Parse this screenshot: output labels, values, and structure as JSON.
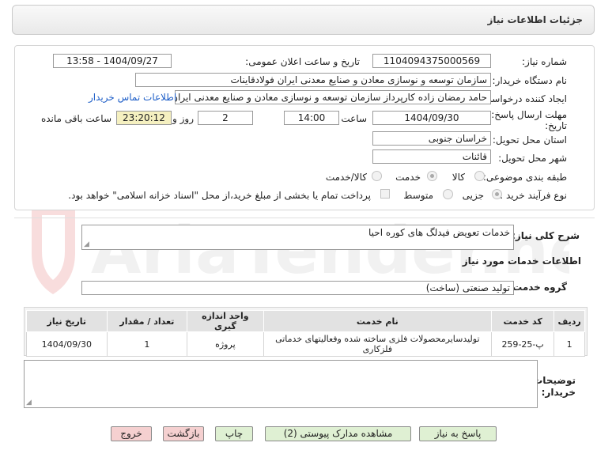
{
  "header": {
    "title": "جزئیات اطلاعات نیاز"
  },
  "form": {
    "need_number_label": "شماره نیاز:",
    "need_number": "1104094375000569",
    "announce_label": "تاریخ و ساعت اعلان عمومی:",
    "announce_value": "1404/09/27 - 13:58",
    "buyer_org_label": "نام دستگاه خریدار:",
    "buyer_org": "سازمان توسعه و نوسازی معادن و صنایع معدنی ایران فولادقاینات",
    "creator_label": "ایجاد کننده درخواست:",
    "creator": "حامد  رمضان زاده  کارپرداز  سازمان توسعه و نوسازی معادن و صنایع معدنی ایران",
    "contact_link": "اطلاعات تماس خریدار",
    "deadline_label_1": "مهلت ارسال پاسخ: تا",
    "deadline_label_2": "تاریخ:",
    "deadline_date": "1404/09/30",
    "time_label": "ساعت",
    "deadline_time": "14:00",
    "days_value": "2",
    "days_label": "روز و",
    "remaining_time": "23:20:12",
    "remaining_label": "ساعت باقی مانده",
    "province_label": "استان محل تحویل:",
    "province": "خراسان جنوبی",
    "city_label": "شهر محل تحویل:",
    "city": "قائنات",
    "category_label": "طبقه بندی موضوعی:",
    "category_options": [
      "کالا",
      "خدمت",
      "کالا/خدمت"
    ],
    "category_selected": "خدمت",
    "process_label": "نوع فرآیند خرید :",
    "process_options": [
      "جزیی",
      "متوسط"
    ],
    "process_selected": "جزیی",
    "payment_note": "پرداخت تمام یا بخشی از مبلغ خرید،از محل \"اسناد خزانه اسلامی\" خواهد بود."
  },
  "summary": {
    "label": "شرح کلی نیاز:",
    "value": "خدمات تعویض فیدلگ های کوره احیا"
  },
  "services": {
    "section_title": "اطلاعات خدمات مورد نیاز",
    "group_label": "گروه خدمت:",
    "group_value": "تولید صنعتی (ساخت)",
    "columns": [
      "ردیف",
      "کد خدمت",
      "نام خدمت",
      "واحد اندازه گیری",
      "تعداد / مقدار",
      "تاریخ نیاز"
    ],
    "rows": [
      {
        "index": "1",
        "code": "پ-25-259",
        "name": "تولیدسایرمحصولات فلزی ساخته شده وفعالیتهای خدماتی فلزکاری",
        "unit": "پروژه",
        "qty": "1",
        "date": "1404/09/30"
      }
    ]
  },
  "buyer_notes": {
    "label_1": "توضیحات",
    "label_2": "خریدار:",
    "value": ""
  },
  "buttons": {
    "reply": "پاسخ به نیاز",
    "attachments": "مشاهده مدارک پیوستی (2)",
    "print": "چاپ",
    "back": "بازگشت",
    "exit": "خروج"
  },
  "watermark": {
    "text": "AriaTender.net"
  }
}
